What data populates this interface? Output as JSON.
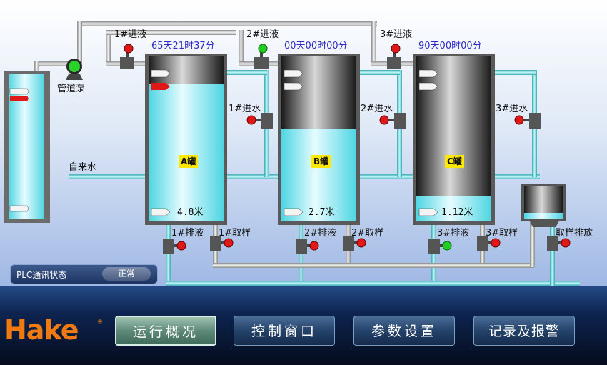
{
  "colors": {
    "accent": "#f07a12",
    "water": "#7ee9f2",
    "pipe": "#5fc8cf",
    "time_text": "#2c2cc8",
    "tank_label_bg": "#ffe800",
    "valve_red": "#e01818",
    "valve_green": "#22cc22"
  },
  "pump": {
    "label": "管道泵"
  },
  "tap_water": {
    "label": "自来水"
  },
  "tanks": [
    {
      "name": "A罐",
      "time": "65天21时37分",
      "level_text": "4.8米",
      "fill_level": 0.78,
      "inlet_valve": "1#进液",
      "water_valve": "1#进水",
      "drain_valve": "1#排液",
      "sample_valve": "1#取样",
      "inlet_state": "red",
      "drain_state": "red"
    },
    {
      "name": "B罐",
      "time": "00天00时00分",
      "level_text": "2.7米",
      "fill_level": 0.45,
      "inlet_valve": "2#进液",
      "water_valve": "2#进水",
      "drain_valve": "2#排液",
      "sample_valve": "2#取样",
      "inlet_state": "green",
      "drain_state": "red"
    },
    {
      "name": "C罐",
      "time": "90天00时00分",
      "level_text": "1.12米",
      "fill_level": 0.18,
      "inlet_valve": "3#进液",
      "water_valve": "3#进水",
      "drain_valve": "3#排液",
      "sample_valve": "3#取样",
      "inlet_state": "red",
      "drain_state": "green"
    }
  ],
  "sample_drain": {
    "label": "取样排放"
  },
  "plc": {
    "label": "PLC通讯状态",
    "status": "正常"
  },
  "brand": {
    "logo": "Hake",
    "reg": "®"
  },
  "nav": [
    {
      "label": "运行概况",
      "active": true
    },
    {
      "label": "控制窗口",
      "active": false
    },
    {
      "label": "参数设置",
      "active": false
    },
    {
      "label": "记录及报警",
      "active": false
    }
  ]
}
